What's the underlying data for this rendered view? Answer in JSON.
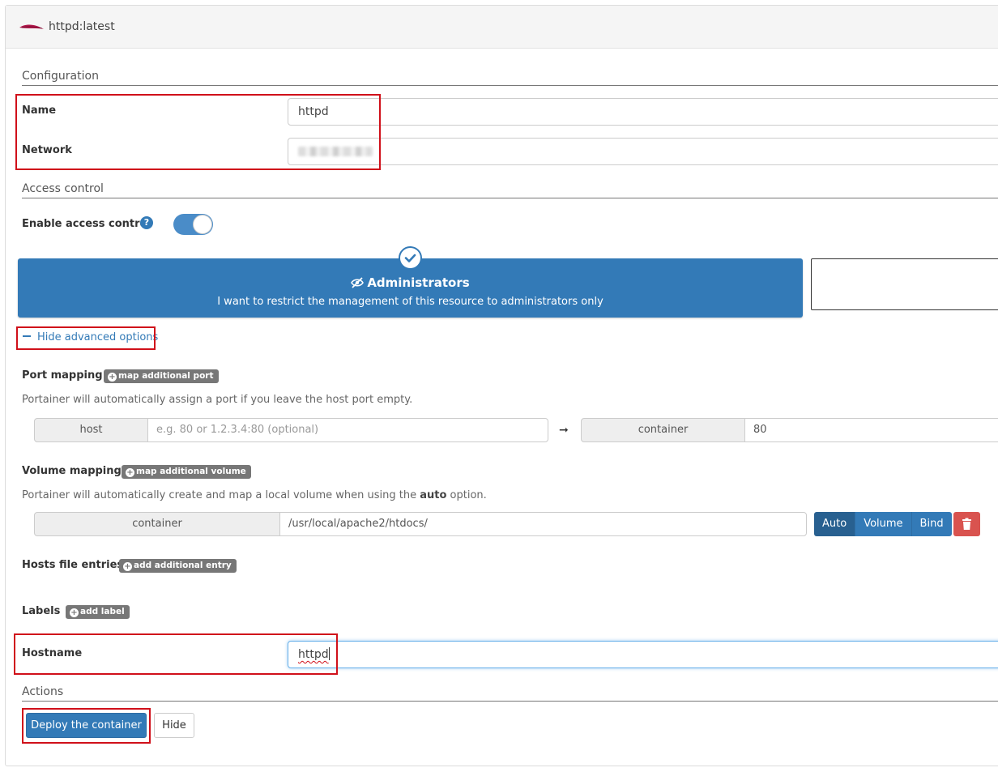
{
  "header": {
    "title": "httpd:latest",
    "logo_icon": "apache-feather-icon"
  },
  "configuration": {
    "section_title": "Configuration",
    "name_label": "Name",
    "name_value": "httpd",
    "network_label": "Network"
  },
  "access_control": {
    "section_title": "Access control",
    "enable_label": "Enable access control",
    "help_glyph": "?",
    "enabled": true,
    "admin_option": {
      "title": "Administrators",
      "description": "I want to restrict the management of this resource to administrators only",
      "selected": true
    }
  },
  "advanced": {
    "toggle_label": "Hide advanced options"
  },
  "port_mapping": {
    "label": "Port mapping",
    "add_label": "map additional port",
    "hint": "Portainer will automatically assign a port if you leave the host port empty.",
    "host_label": "host",
    "host_placeholder": "e.g. 80 or 1.2.3.4:80 (optional)",
    "arrow": "➞",
    "container_label": "container",
    "container_value": "80"
  },
  "volume_mapping": {
    "label": "Volume mapping",
    "add_label": "map additional volume",
    "hint_prefix": "Portainer will automatically create and map a local volume when using the",
    "hint_bold": "auto",
    "hint_suffix": "option.",
    "container_label": "container",
    "container_value": "/usr/local/apache2/htdocs/",
    "modes": [
      "Auto",
      "Volume",
      "Bind"
    ],
    "active_mode": "Auto"
  },
  "hosts_file": {
    "label": "Hosts file entries",
    "add_label": "add additional entry"
  },
  "labels": {
    "label": "Labels",
    "add_label": "add label"
  },
  "hostname": {
    "label": "Hostname",
    "value": "httpd"
  },
  "actions": {
    "section_title": "Actions",
    "deploy_label": "Deploy the container",
    "hide_label": "Hide"
  },
  "colors": {
    "primary": "#337ab7",
    "danger": "#d9534f",
    "highlight": "#d0101a"
  }
}
